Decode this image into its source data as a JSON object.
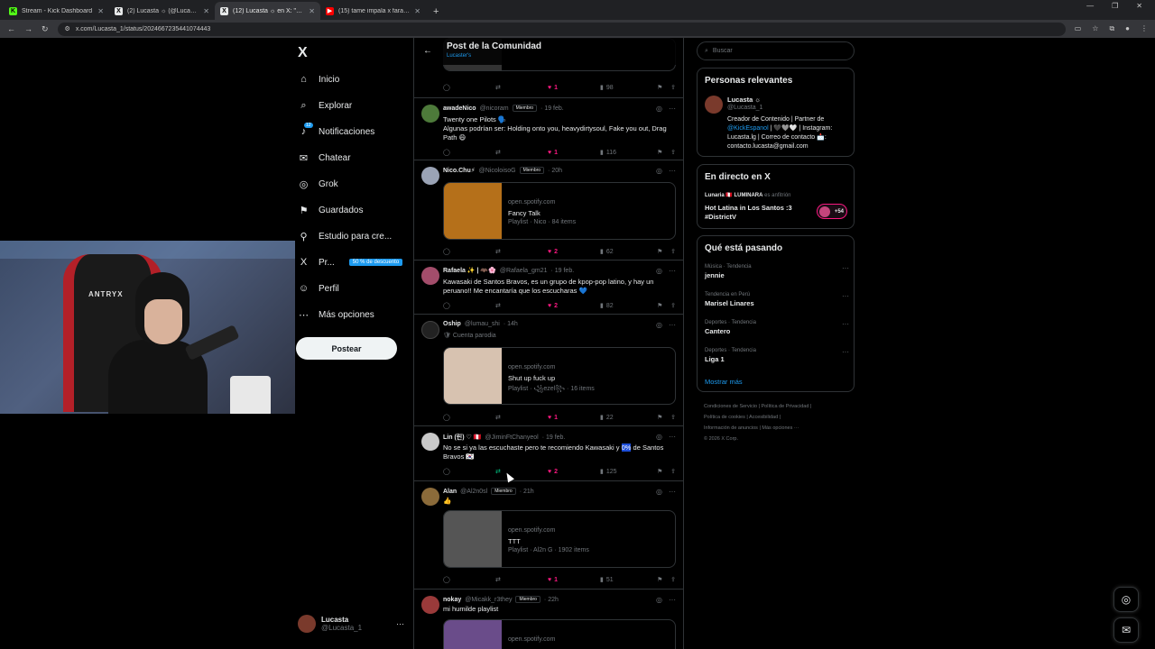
{
  "browser": {
    "tabs": [
      {
        "title": "Stream - Kick Dashboard",
        "fav_color": "#53fc18",
        "fav": "K"
      },
      {
        "title": "(2) Lucasta ☼ (@Lucasta_1) / X",
        "fav_color": "#e7e9ea",
        "fav": "X"
      },
      {
        "title": "(12) Lucasta ☼ en X: \"Hola, rec",
        "fav_color": "#e7e9ea",
        "fav": "X",
        "active": true
      },
      {
        "title": "(15) tame impala x faraón love",
        "fav_color": "#ff0000",
        "fav": "▶"
      }
    ],
    "new_tab": "+",
    "url": "x.com/Lucasta_1/status/2024667235441074443"
  },
  "nav": {
    "logo": "X",
    "items": [
      {
        "label": "Inicio",
        "icon": "⌂"
      },
      {
        "label": "Explorar",
        "icon": "⌕"
      },
      {
        "label": "Notificaciones",
        "icon": "🔔",
        "count": "12"
      },
      {
        "label": "Chatear",
        "icon": "✉"
      },
      {
        "label": "Grok",
        "icon": "◎"
      },
      {
        "label": "Guardados",
        "icon": "⚑"
      },
      {
        "label": "Estudio para cre...",
        "icon": "⚲"
      },
      {
        "label": "Pr...",
        "icon": "X",
        "badge": "50 % de descuento"
      },
      {
        "label": "Perfil",
        "icon": "☺"
      },
      {
        "label": "Más opciones",
        "icon": "⋯"
      }
    ],
    "post_button": "Postear",
    "account": {
      "name": "Lucasta",
      "handle": "@Lucasta_1"
    }
  },
  "webcam": {
    "chair_logo": "ANTRYX"
  },
  "main": {
    "header_title": "Post de la Comunidad",
    "header_sub": "Lucaster's",
    "posts": [
      {
        "stats": {
          "reply": "",
          "repost": "",
          "like": "1",
          "views": "98"
        }
      },
      {
        "name": "awadeNico",
        "handle": "@nicoram",
        "member": "Miembro",
        "time": "· 19 feb.",
        "avatar_color": "#4d7a3a",
        "text": "Twenty one Pilots 🗣️\nAlgunas podrían ser: Holding onto you, heavydirtysoul, Fake you out, Drag Path 😄",
        "stats": {
          "reply": "",
          "repost": "",
          "like": "1",
          "views": "116"
        }
      },
      {
        "name": "Nico.Chu⚡",
        "handle": "@NicoloisoG",
        "member": "Miembro",
        "time": "· 20h",
        "avatar_color": "#9aa3b5",
        "card": {
          "domain": "open.spotify.com",
          "title": "Fancy Talk",
          "desc": "Playlist · Nico · 84 items",
          "thumb": "#b5701a"
        },
        "stats": {
          "reply": "",
          "repost": "",
          "like": "2",
          "views": "62"
        }
      },
      {
        "name": "Rafaela ✨ | 🦇🌸",
        "handle": "@Rafaela_gm21",
        "member": "",
        "time": "· 19 feb.",
        "avatar_color": "#a34d6b",
        "text": "Kawasaki de Santos Bravos, es un grupo de kpop-pop latino, y hay un peruano!! Me encantaría que los escucharas 💙",
        "stats": {
          "reply": "",
          "repost": "",
          "like": "2",
          "views": "82"
        }
      },
      {
        "name": "Oship",
        "handle": "@lumau_shi",
        "member": "",
        "time": "· 14h",
        "avatar_color": "#222",
        "parody": "🛡 Cuenta parodia",
        "card": {
          "domain": "open.spotify.com",
          "title": "Shut up fuck up",
          "desc": "Playlist · ꧁ezel꧂ · 16 items",
          "thumb": "#d7c2b0"
        },
        "stats": {
          "reply": "",
          "repost": "",
          "like": "1",
          "views": "22"
        }
      },
      {
        "name": "Lin (린) ♡ 🇵🇪",
        "handle": "@JiminFtChanyeol",
        "member": "",
        "time": "· 19 feb.",
        "avatar_color": "#c9c9c9",
        "text_pre": "No se si ya las escuchaste pero te recomiendo Kawasaki y ",
        "text_hl": "0%",
        "text_post": " de Santos Bravos 🇰🇷",
        "stats": {
          "reply": "",
          "repost": "",
          "like": "2",
          "views": "125"
        }
      },
      {
        "name": "Alan",
        "handle": "@Al2n0sl",
        "member": "Miembro",
        "time": "· 21h",
        "avatar_color": "#8b6b3a",
        "text": "👍",
        "card": {
          "domain": "open.spotify.com",
          "title": "TTT",
          "desc": "Playlist · Al2n G · 1902 items",
          "thumb": "#555"
        },
        "stats": {
          "reply": "",
          "repost": "",
          "like": "1",
          "views": "51"
        }
      },
      {
        "name": "nokay",
        "handle": "@Micakk_r3they",
        "member": "Miembro",
        "time": "· 22h",
        "avatar_color": "#9a3a3a",
        "text": "mi humilde playlist",
        "card": {
          "domain": "open.spotify.com",
          "title": "",
          "desc": "",
          "thumb": "#6a4c8a"
        }
      }
    ]
  },
  "right": {
    "search_placeholder": "Buscar",
    "relevant": {
      "title": "Personas relevantes",
      "name": "Lucasta ☼",
      "handle": "@Lucasta_1",
      "bio_1": "Creador de Contenido | Partner de ",
      "bio_link": "@KickEspanol",
      "bio_2": " | 🖤🩶🤍 | Instagram: Lucasta.lg | Correo de contacto 📩: contacto.lucasta@gmail.com"
    },
    "live": {
      "title": "En directo en X",
      "host_name": "Lunaria 🇵🇪 LUMINARA",
      "host_role": "es anfitrión",
      "stream_title": "Hot Latina in Los Santos :3 #DistrictV",
      "listeners": "+54"
    },
    "trends": {
      "title": "Qué está pasando",
      "items": [
        {
          "context": "Música · Tendencia",
          "name": "jennie"
        },
        {
          "context": "Tendencia en Perú",
          "name": "Marisel Linares"
        },
        {
          "context": "Deportes · Tendencia",
          "name": "Cantero"
        },
        {
          "context": "Deportes · Tendencia",
          "name": "Liga 1"
        }
      ],
      "more": "Mostrar más"
    },
    "footer": {
      "line1": "Condiciones de Servicio  |  Política de Privacidad  |",
      "line2": "Política de cookies  |  Accesibilidad  |",
      "line3": "Información de anuncios  |  Más opciones ···",
      "line4": "© 2026 X Corp."
    }
  }
}
